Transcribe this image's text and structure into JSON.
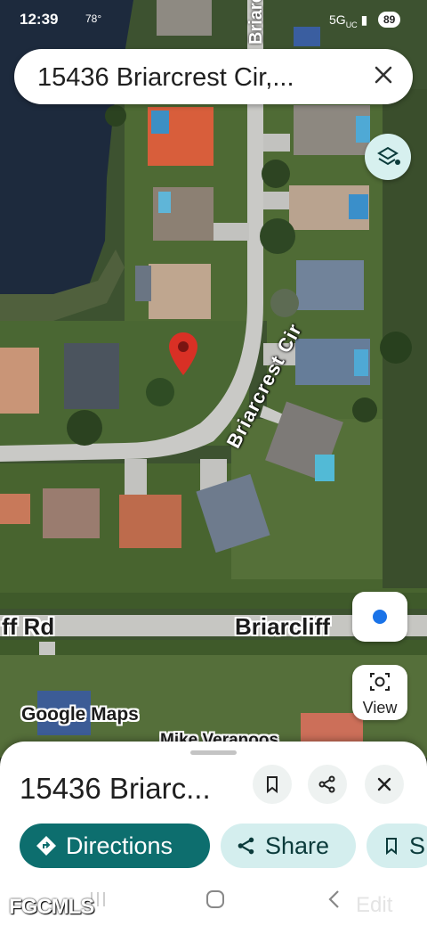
{
  "status_bar": {
    "time": "12:39",
    "temperature": "78°",
    "network": "5G",
    "network_sup": "UC",
    "battery": "89"
  },
  "search": {
    "query": "15436 Briarcrest Cir,..."
  },
  "map": {
    "street_curve": "Briarcrest Cir",
    "street_top": "Briarcrest Cir",
    "street_bottom_left": "ff Rd",
    "street_bottom_right": "Briarcliff",
    "attribution": "Google Maps",
    "poi_partial": "Mike Veranoos",
    "view_label": "View",
    "icons": [
      "layers-icon",
      "my-location-icon",
      "view-camera-icon",
      "location-pin-icon"
    ],
    "colors": {
      "pin": "#d93025",
      "location_dot": "#1a73e8",
      "accent": "#0d6e6e"
    }
  },
  "sheet": {
    "title": "15436 Briarc...",
    "actions": {
      "directions": "Directions",
      "share": "Share",
      "save": "S"
    }
  },
  "watermark": "FGCMLS",
  "edit_label": "Edit"
}
